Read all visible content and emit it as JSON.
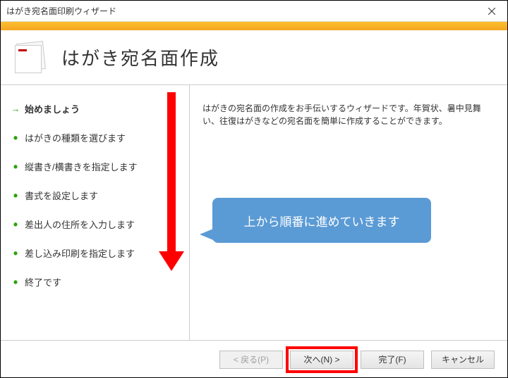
{
  "window": {
    "title": "はがき宛名面印刷ウィザード"
  },
  "header": {
    "title": "はがき宛名面作成"
  },
  "steps": [
    {
      "label": "始めましょう",
      "current": true
    },
    {
      "label": "はがきの種類を選びます",
      "current": false
    },
    {
      "label": "縦書き/横書きを指定します",
      "current": false
    },
    {
      "label": "書式を設定します",
      "current": false
    },
    {
      "label": "差出人の住所を入力します",
      "current": false
    },
    {
      "label": "差し込み印刷を指定します",
      "current": false
    },
    {
      "label": "終了です",
      "current": false
    }
  ],
  "content": {
    "description": "はがきの宛名面の作成をお手伝いするウィザードです。年賀状、暑中見舞い、往復はがきなどの宛名面を簡単に作成することができます。"
  },
  "buttons": {
    "back": "< 戻る(P)",
    "next": "次へ(N) >",
    "finish": "完了(F)",
    "cancel": "キャンセル"
  },
  "annotation": {
    "callout": "上から順番に進めていきます"
  }
}
